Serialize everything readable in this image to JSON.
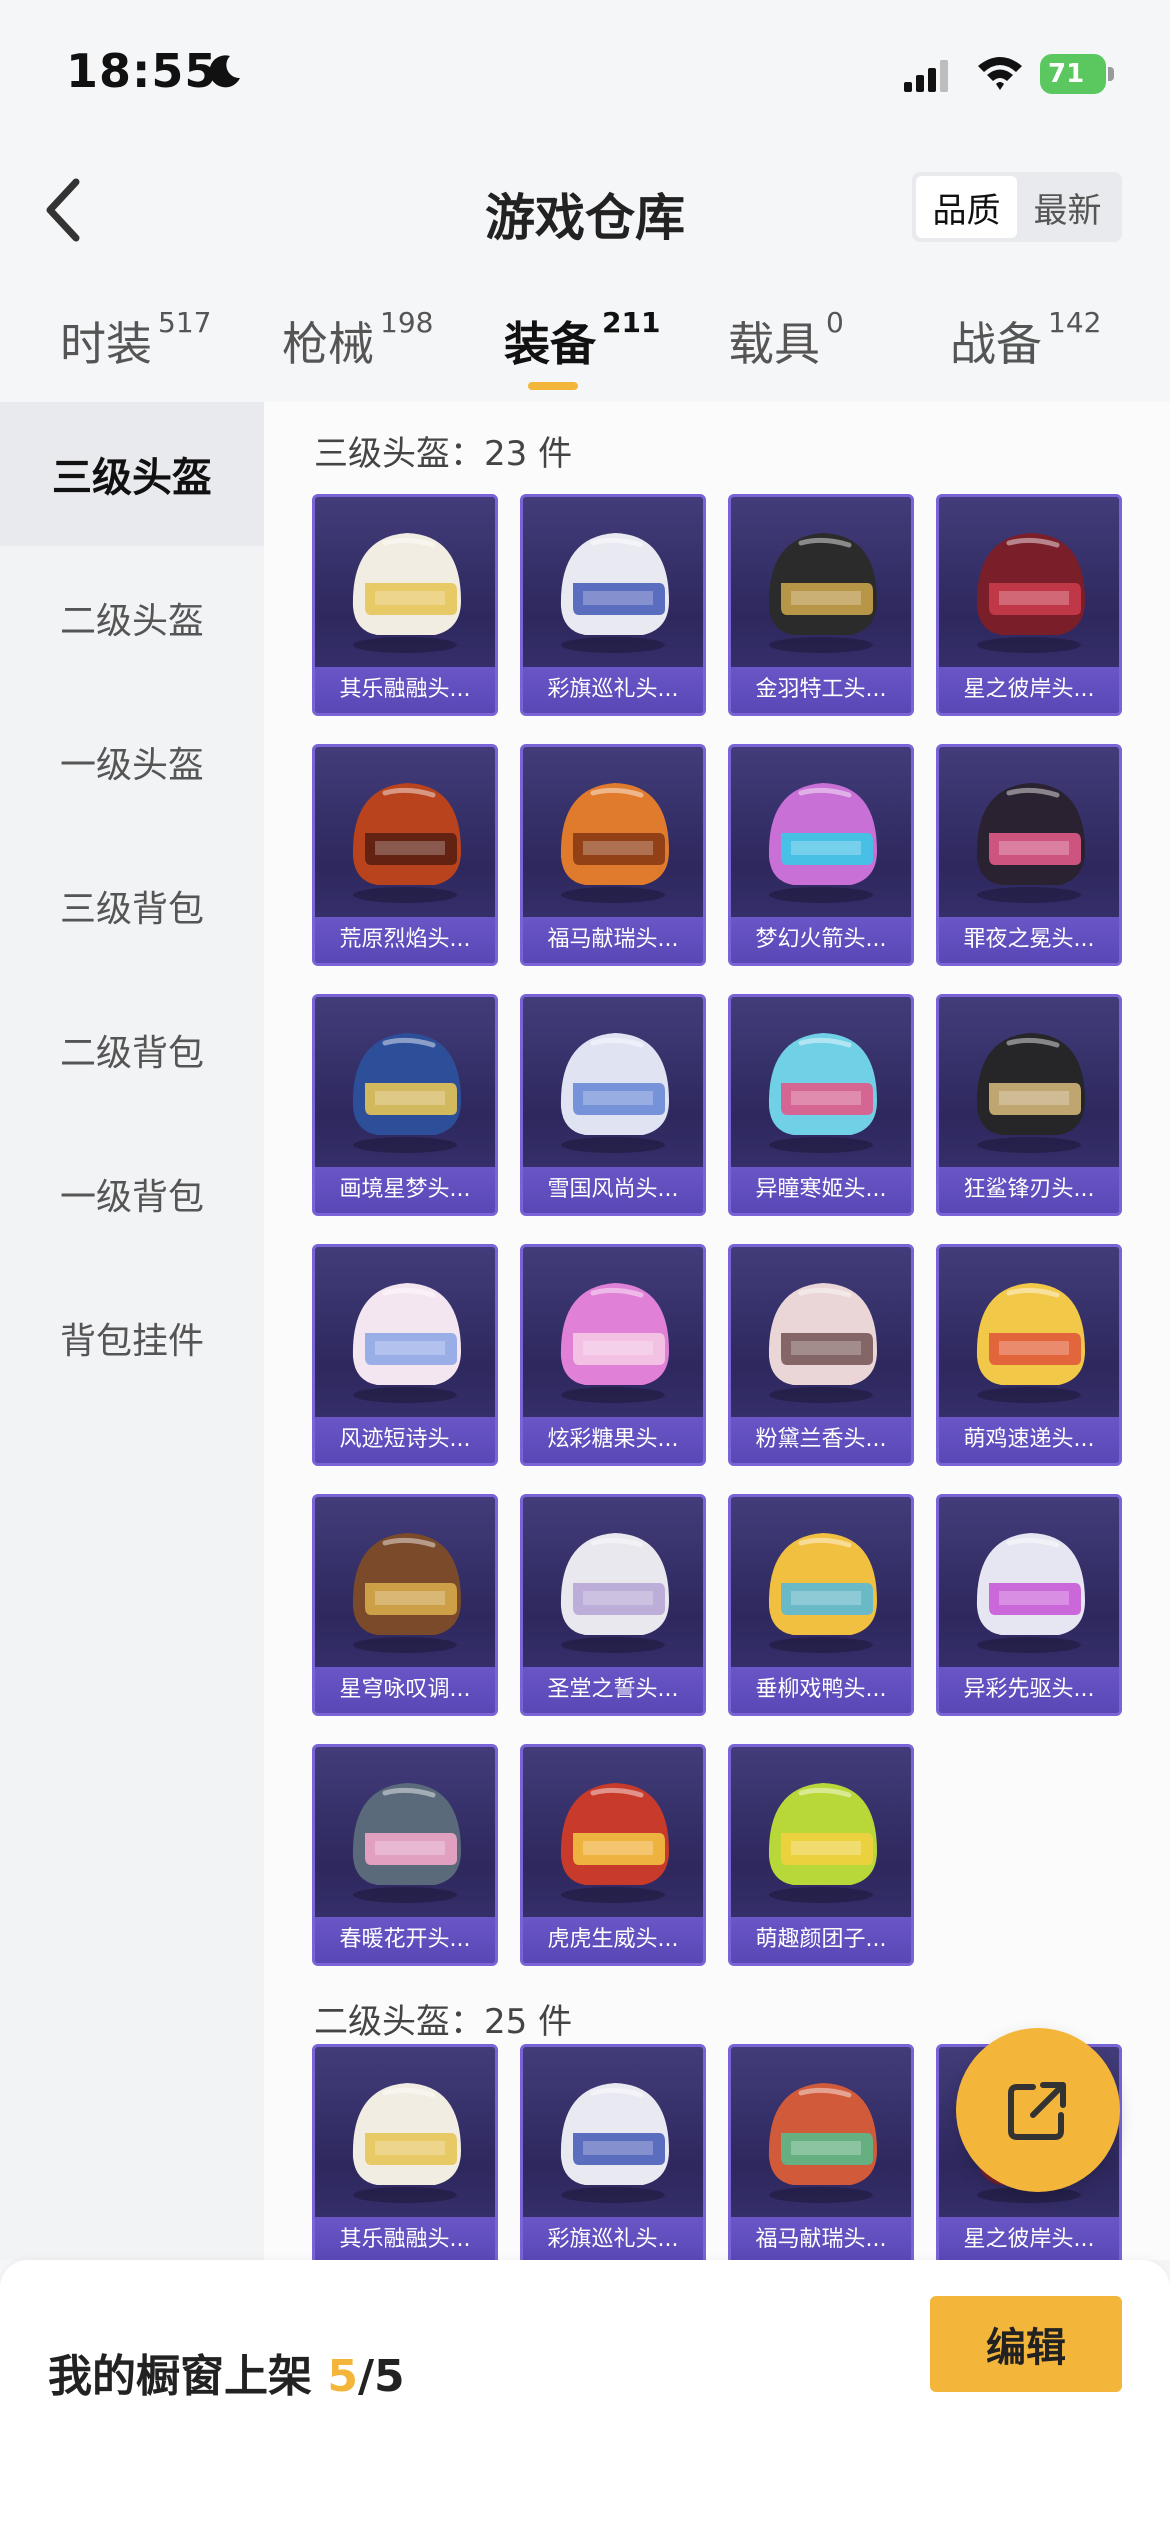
{
  "status_bar": {
    "time": "18:55",
    "battery": "71"
  },
  "header": {
    "title": "游戏仓库",
    "sort_options": [
      "品质",
      "最新"
    ],
    "active_sort": "品质"
  },
  "category_tabs": [
    {
      "label": "时装",
      "count": "517"
    },
    {
      "label": "枪械",
      "count": "198"
    },
    {
      "label": "装备",
      "count": "211",
      "active": true
    },
    {
      "label": "载具",
      "count": "0"
    },
    {
      "label": "战备",
      "count": "142"
    }
  ],
  "sidebar": {
    "items": [
      "三级头盔",
      "二级头盔",
      "一级头盔",
      "三级背包",
      "二级背包",
      "一级背包",
      "背包挂件"
    ],
    "active": "三级头盔"
  },
  "sections": [
    {
      "title": "三级头盔：23 件",
      "items": [
        {
          "name": "其乐融融头...",
          "color": "#f2ede2",
          "accent": "#e6c458"
        },
        {
          "name": "彩旗巡礼头...",
          "color": "#e9e9f2",
          "accent": "#4b5fb8"
        },
        {
          "name": "金羽特工头...",
          "color": "#2b2b2b",
          "accent": "#c8a24a"
        },
        {
          "name": "星之彼岸头...",
          "color": "#7a1f2a",
          "accent": "#c83a4a"
        },
        {
          "name": "荒原烈焰头...",
          "color": "#b8431d",
          "accent": "#5a1f12"
        },
        {
          "name": "福马献瑞头...",
          "color": "#e07a2c",
          "accent": "#8a3a14"
        },
        {
          "name": "梦幻火箭头...",
          "color": "#c870d6",
          "accent": "#3ac8e6"
        },
        {
          "name": "罪夜之冕头...",
          "color": "#2a2230",
          "accent": "#e05a8a"
        },
        {
          "name": "画境星梦头...",
          "color": "#2d4f9a",
          "accent": "#e6c458"
        },
        {
          "name": "雪国风尚头...",
          "color": "#dfe3f2",
          "accent": "#6a8ad6"
        },
        {
          "name": "异瞳寒姬头...",
          "color": "#6fd0e6",
          "accent": "#e05a8a"
        },
        {
          "name": "狂鲨锋刃头...",
          "color": "#262628",
          "accent": "#d0b478"
        },
        {
          "name": "风迹短诗头...",
          "color": "#f4e6f0",
          "accent": "#8fa6e6"
        },
        {
          "name": "炫彩糖果头...",
          "color": "#e080d6",
          "accent": "#f4c8e6"
        },
        {
          "name": "粉黛兰香头...",
          "color": "#ead6d6",
          "accent": "#7a5a5a"
        },
        {
          "name": "萌鸡速递头...",
          "color": "#f2c848",
          "accent": "#e05a3a"
        },
        {
          "name": "星穹咏叹调...",
          "color": "#7a4a2a",
          "accent": "#d6a84a"
        },
        {
          "name": "圣堂之誓头...",
          "color": "#e8e8ee",
          "accent": "#b8a6d6"
        },
        {
          "name": "垂柳戏鸭头...",
          "color": "#f2c040",
          "accent": "#5ab8d6"
        },
        {
          "name": "异彩先驱头...",
          "color": "#e6e6f2",
          "accent": "#c85ad6"
        },
        {
          "name": "春暖花开头...",
          "color": "#5a6a7a",
          "accent": "#f0a6c8"
        },
        {
          "name": "虎虎生威头...",
          "color": "#c83a2a",
          "accent": "#f2c040"
        },
        {
          "name": "萌趣颜团子...",
          "color": "#b8d83a",
          "accent": "#f2d040"
        }
      ]
    },
    {
      "title": "二级头盔：25 件",
      "items": [
        {
          "name": "其乐融融头...",
          "color": "#f2ede2",
          "accent": "#e6c458"
        },
        {
          "name": "彩旗巡礼头...",
          "color": "#e9e9f2",
          "accent": "#4b5fb8"
        },
        {
          "name": "福马献瑞头...",
          "color": "#d05a3a",
          "accent": "#5ab88a"
        },
        {
          "name": "星之彼岸头...",
          "color": "#7a1f2a",
          "accent": "#c83a4a"
        }
      ]
    }
  ],
  "bottom_bar": {
    "label": "我的橱窗上架 ",
    "count_current": "5",
    "count_total": "/5",
    "edit_label": "编辑"
  },
  "colors": {
    "accent": "#f4b63a",
    "card_bg": "#2e285e",
    "card_label_bg": "#5a47b6"
  }
}
